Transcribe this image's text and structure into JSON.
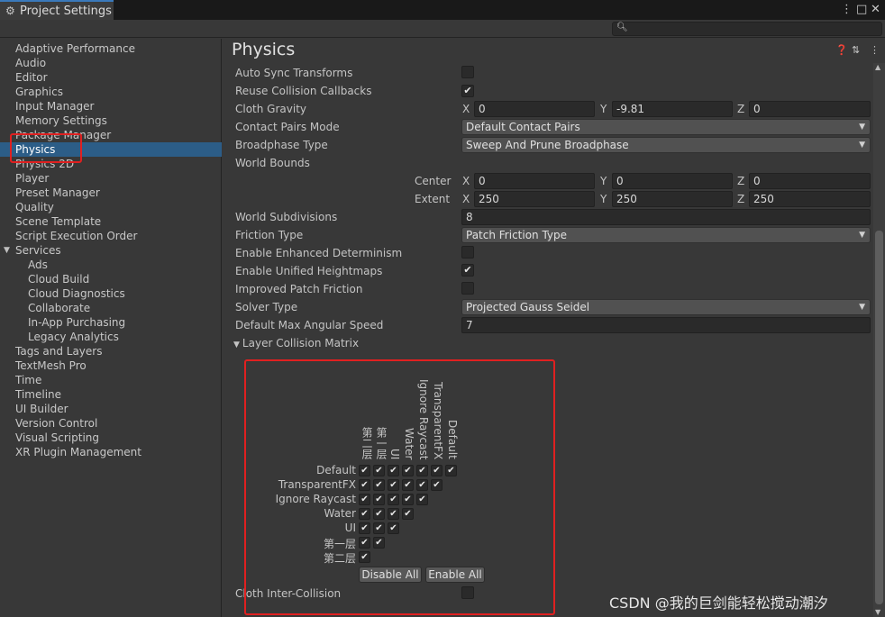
{
  "window": {
    "tab_title": "Project Settings",
    "controls": [
      "⋮",
      "□",
      "✕"
    ]
  },
  "sidebar": {
    "items": [
      {
        "label": "Adaptive Performance",
        "indent": 0
      },
      {
        "label": "Audio",
        "indent": 0
      },
      {
        "label": "Editor",
        "indent": 0
      },
      {
        "label": "Graphics",
        "indent": 0
      },
      {
        "label": "Input Manager",
        "indent": 0
      },
      {
        "label": "Memory Settings",
        "indent": 0
      },
      {
        "label": "Package Manager",
        "indent": 0
      },
      {
        "label": "Physics",
        "indent": 0,
        "selected": true
      },
      {
        "label": "Physics 2D",
        "indent": 0
      },
      {
        "label": "Player",
        "indent": 0
      },
      {
        "label": "Preset Manager",
        "indent": 0
      },
      {
        "label": "Quality",
        "indent": 0
      },
      {
        "label": "Scene Template",
        "indent": 0
      },
      {
        "label": "Script Execution Order",
        "indent": 0
      },
      {
        "label": "Services",
        "indent": 0,
        "foldout": "▼"
      },
      {
        "label": "Ads",
        "indent": 1
      },
      {
        "label": "Cloud Build",
        "indent": 1
      },
      {
        "label": "Cloud Diagnostics",
        "indent": 1
      },
      {
        "label": "Collaborate",
        "indent": 1
      },
      {
        "label": "In-App Purchasing",
        "indent": 1
      },
      {
        "label": "Legacy Analytics",
        "indent": 1
      },
      {
        "label": "Tags and Layers",
        "indent": 0
      },
      {
        "label": "TextMesh Pro",
        "indent": 0
      },
      {
        "label": "Time",
        "indent": 0
      },
      {
        "label": "Timeline",
        "indent": 0
      },
      {
        "label": "UI Builder",
        "indent": 0
      },
      {
        "label": "Version Control",
        "indent": 0
      },
      {
        "label": "Visual Scripting",
        "indent": 0
      },
      {
        "label": "XR Plugin Management",
        "indent": 0
      }
    ]
  },
  "main": {
    "title": "Physics",
    "header_icons": [
      "help-icon",
      "preset-icon",
      "more-icon"
    ],
    "auto_sync_transforms": {
      "label": "Auto Sync Transforms",
      "checked": false
    },
    "reuse_collision_callbacks": {
      "label": "Reuse Collision Callbacks",
      "checked": true
    },
    "cloth_gravity": {
      "label": "Cloth Gravity",
      "x": "0",
      "y": "-9.81",
      "z": "0"
    },
    "contact_pairs_mode": {
      "label": "Contact Pairs Mode",
      "value": "Default Contact Pairs"
    },
    "broadphase_type": {
      "label": "Broadphase Type",
      "value": "Sweep And Prune Broadphase"
    },
    "world_bounds": {
      "label": "World Bounds",
      "center_label": "Center",
      "center": {
        "x": "0",
        "y": "0",
        "z": "0"
      },
      "extent_label": "Extent",
      "extent": {
        "x": "250",
        "y": "250",
        "z": "250"
      }
    },
    "axis_labels": {
      "x": "X",
      "y": "Y",
      "z": "Z"
    },
    "world_subdivisions": {
      "label": "World Subdivisions",
      "value": "8"
    },
    "friction_type": {
      "label": "Friction Type",
      "value": "Patch Friction Type"
    },
    "enhanced_determinism": {
      "label": "Enable Enhanced Determinism",
      "checked": false
    },
    "unified_heightmaps": {
      "label": "Enable Unified Heightmaps",
      "checked": true
    },
    "improved_patch_friction": {
      "label": "Improved Patch Friction",
      "checked": false
    },
    "solver_type": {
      "label": "Solver Type",
      "value": "Projected Gauss Seidel"
    },
    "default_max_angular_speed": {
      "label": "Default Max Angular Speed",
      "value": "7"
    },
    "layer_collision_matrix": {
      "label": "Layer Collision Matrix",
      "layers": [
        "Default",
        "TransparentFX",
        "Ignore Raycast",
        "Water",
        "UI",
        "第一层",
        "第二层"
      ],
      "disable_all": "Disable All",
      "enable_all": "Enable All"
    },
    "cloth_inter_collision": {
      "label": "Cloth Inter-Collision",
      "checked": false
    }
  },
  "watermark": "CSDN @我的巨剑能轻松搅动潮汐",
  "colors": {
    "selection": "#2c5d87",
    "annotation_red": "#e02020",
    "tab_accent": "#3a79bb"
  }
}
